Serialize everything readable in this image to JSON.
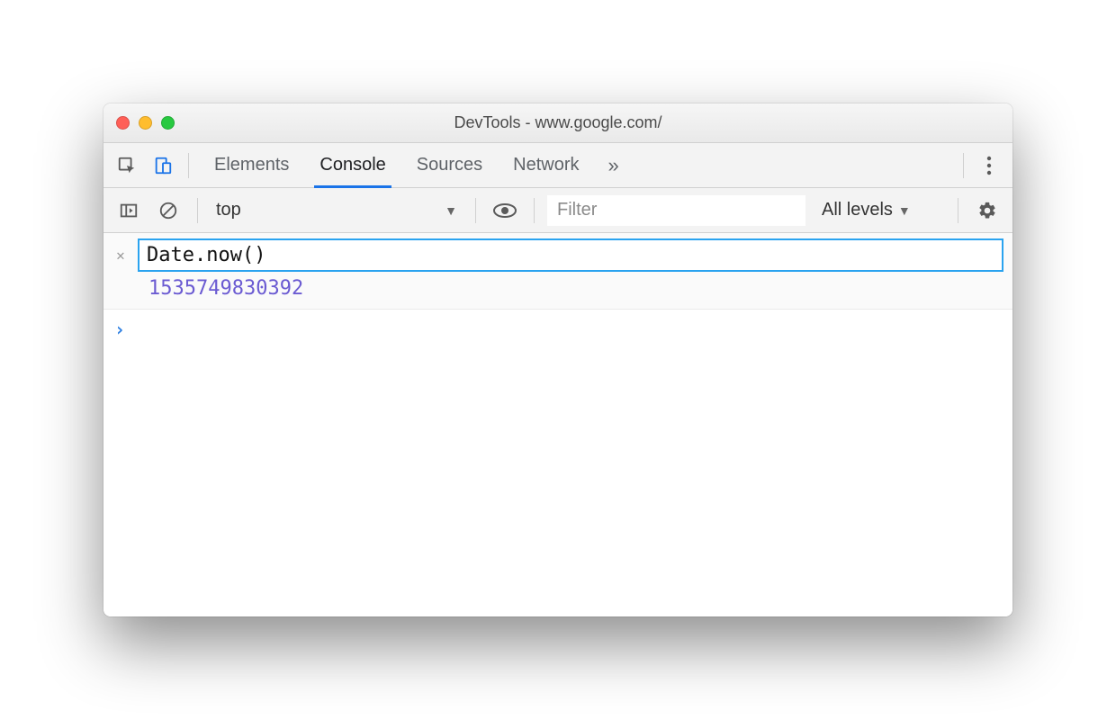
{
  "window": {
    "title": "DevTools - www.google.com/"
  },
  "tabs": {
    "elements": "Elements",
    "console": "Console",
    "sources": "Sources",
    "network": "Network"
  },
  "filterbar": {
    "context": "top",
    "filter_placeholder": "Filter",
    "levels": "All levels"
  },
  "console": {
    "input_value": "Date.now()",
    "eager_result": "1535749830392"
  }
}
